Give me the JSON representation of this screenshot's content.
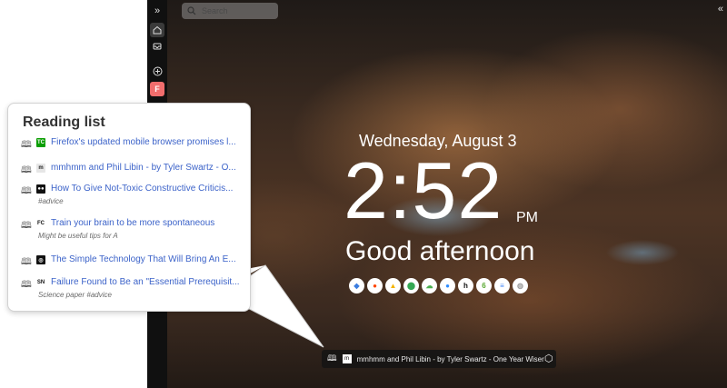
{
  "browser": {
    "search_placeholder": "Search",
    "left_rail": {
      "expand_glyph": "»",
      "profile_initial": "F"
    },
    "collapse_glyph": "«"
  },
  "new_tab": {
    "date": "Wednesday, August 3",
    "time": "2:52",
    "ampm": "PM",
    "greeting": "Good afternoon",
    "shortcuts": [
      {
        "name": "drive-shortcut",
        "glyph": "◆",
        "color": "#3b7de0"
      },
      {
        "name": "reddit-shortcut",
        "glyph": "●",
        "color": "#ff4500"
      },
      {
        "name": "google-drive-shortcut",
        "glyph": "▲",
        "color": "#f4b400"
      },
      {
        "name": "google-maps-shortcut",
        "glyph": "⬤",
        "color": "#34a853"
      },
      {
        "name": "cloud-shortcut",
        "glyph": "☁",
        "color": "#4caf50"
      },
      {
        "name": "zoom-shortcut",
        "glyph": "●",
        "color": "#2d8cff"
      },
      {
        "name": "hacker-shortcut",
        "glyph": "h",
        "color": "#111111"
      },
      {
        "name": "sprout-shortcut",
        "glyph": "6",
        "color": "#5aa832"
      },
      {
        "name": "docs-shortcut",
        "glyph": "≡",
        "color": "#4285f4"
      },
      {
        "name": "more-shortcut",
        "glyph": "◍",
        "color": "#9e9e9e"
      }
    ],
    "bottom_bar": {
      "favicon": "m",
      "text": "mmhmm and Phil Libin - by Tyler Swartz - One Year Wiser"
    }
  },
  "reading_list": {
    "title": "Reading list",
    "items": [
      {
        "favicon": "TC",
        "favicon_bg": "#0a9e01",
        "favicon_fg": "#ffffff",
        "title": "Firefox's updated mobile browser promises l...",
        "note": ""
      },
      {
        "favicon": "m",
        "favicon_bg": "#e6e6e6",
        "favicon_fg": "#222222",
        "title": "mmhmm and Phil Libin - by Tyler Swartz - O...",
        "note": ""
      },
      {
        "favicon": "●●",
        "favicon_bg": "#111111",
        "favicon_fg": "#ffffff",
        "title": "How To Give Not-Toxic Constructive Criticis...",
        "note": "#advice"
      },
      {
        "favicon": "FC",
        "favicon_bg": "#ffffff",
        "favicon_fg": "#111111",
        "title": "Train your brain to be more spontaneous",
        "note": "Might be useful tips for A"
      },
      {
        "favicon": "◎",
        "favicon_bg": "#111111",
        "favicon_fg": "#ffffff",
        "title": "The Simple Technology That Will Bring An E...",
        "note": ""
      },
      {
        "favicon": "SN",
        "favicon_bg": "#ffffff",
        "favicon_fg": "#111111",
        "title": "Failure Found to Be an \"Essential Prerequisit...",
        "note": "Science paper #advice"
      }
    ]
  }
}
